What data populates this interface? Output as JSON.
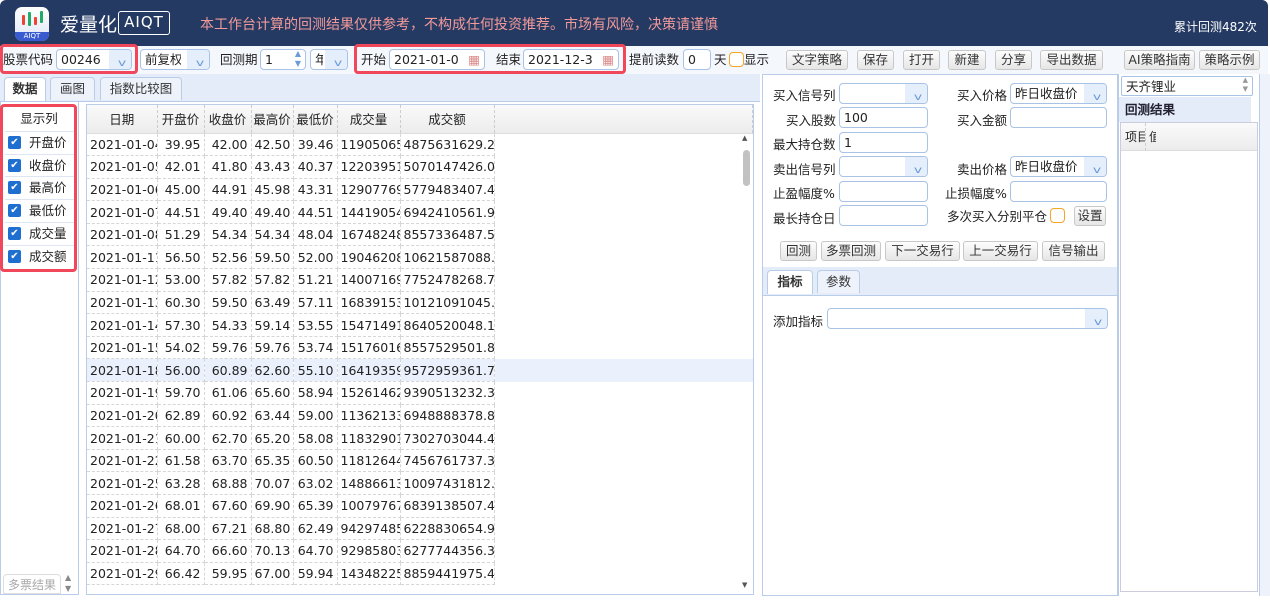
{
  "header": {
    "logo_text": "AIQT",
    "app_name": "爱量化",
    "badge": "AIQT",
    "disclaimer": "本工作台计算的回测结果仅供参考，不构成任何投资推荐。市场有风险，决策请谨慎",
    "counter": "累计回测482次"
  },
  "toolbar": {
    "stock_code_label": "股票代码",
    "stock_code": "00246",
    "adjust": "前复权",
    "period_label": "回测期",
    "period_value": "1",
    "period_unit": "年",
    "start_label": "开始",
    "start_date": "2021-01-0",
    "end_label": "结束",
    "end_date": "2021-12-3",
    "preload_label": "提前读数",
    "preload_value": "0",
    "day_label": "天",
    "show_label": "显示",
    "buttons": [
      "文字策略",
      "保存",
      "打开",
      "新建",
      "分享",
      "导出数据",
      "AI策略指南",
      "策略示例"
    ]
  },
  "tabs": [
    "数据",
    "画图",
    "指数比较图"
  ],
  "columns_panel": {
    "title": "显示列",
    "items": [
      "开盘价",
      "收盘价",
      "最高价",
      "最低价",
      "成交量",
      "成交额"
    ],
    "multi_results": "多票结果"
  },
  "table": {
    "headers": [
      "日期",
      "开盘价",
      "收盘价",
      "最高价",
      "最低价",
      "成交量",
      "成交额"
    ],
    "rows": [
      [
        "2021-01-04",
        "39.95",
        "42.00",
        "42.50",
        "39.46",
        "119050657",
        "4875631629.20"
      ],
      [
        "2021-01-05",
        "42.01",
        "41.80",
        "43.43",
        "40.37",
        "122039516",
        "5070147426.00"
      ],
      [
        "2021-01-06",
        "45.00",
        "44.91",
        "45.98",
        "43.31",
        "129077691",
        "5779483407.42"
      ],
      [
        "2021-01-07",
        "44.51",
        "49.40",
        "49.40",
        "44.51",
        "144190548",
        "6942410561.97"
      ],
      [
        "2021-01-08",
        "51.29",
        "54.34",
        "54.34",
        "48.04",
        "167482482",
        "8557336487.56"
      ],
      [
        "2021-01-11",
        "56.50",
        "52.56",
        "59.50",
        "52.00",
        "190462089",
        "10621587088.2"
      ],
      [
        "2021-01-12",
        "53.00",
        "57.82",
        "57.82",
        "51.21",
        "140071699",
        "7752478268.78"
      ],
      [
        "2021-01-13",
        "60.30",
        "59.50",
        "63.49",
        "57.11",
        "168391532",
        "10121091045.6"
      ],
      [
        "2021-01-14",
        "57.30",
        "54.33",
        "59.14",
        "53.55",
        "154714912",
        "8640520048.11"
      ],
      [
        "2021-01-15",
        "54.02",
        "59.76",
        "59.76",
        "53.74",
        "151760166",
        "8557529501.84"
      ],
      [
        "2021-01-18",
        "56.00",
        "60.89",
        "62.60",
        "55.10",
        "164193598",
        "9572959361.71"
      ],
      [
        "2021-01-19",
        "59.70",
        "61.06",
        "65.60",
        "58.94",
        "152614628",
        "9390513232.32"
      ],
      [
        "2021-01-20",
        "62.89",
        "60.92",
        "63.44",
        "59.00",
        "113621339",
        "6948888378.84"
      ],
      [
        "2021-01-21",
        "60.00",
        "62.70",
        "65.20",
        "58.08",
        "118329014",
        "7302703044.44"
      ],
      [
        "2021-01-22",
        "61.58",
        "63.70",
        "65.35",
        "60.50",
        "118126442",
        "7456761737.35"
      ],
      [
        "2021-01-25",
        "63.28",
        "68.88",
        "70.07",
        "63.02",
        "148866139",
        "10097431812.6"
      ],
      [
        "2021-01-26",
        "68.01",
        "67.60",
        "69.90",
        "65.39",
        "100797678",
        "6839138507.48"
      ],
      [
        "2021-01-27",
        "68.00",
        "67.21",
        "68.80",
        "62.49",
        "94297485",
        "6228830654.97"
      ],
      [
        "2021-01-28",
        "64.70",
        "66.60",
        "70.13",
        "64.70",
        "92985803",
        "6277744356.39"
      ],
      [
        "2021-01-29",
        "66.42",
        "59.95",
        "67.00",
        "59.94",
        "143482252",
        "8859441975.41"
      ]
    ],
    "selected_row": 10
  },
  "form": {
    "buy_signal_label": "买入信号列",
    "buy_signal": "",
    "buy_price_label": "买入价格",
    "buy_price": "昨日收盘价",
    "buy_shares_label": "买入股数",
    "buy_shares": "100",
    "buy_amount_label": "买入金额",
    "buy_amount": "",
    "max_pos_label": "最大持仓数",
    "max_pos": "1",
    "sell_signal_label": "卖出信号列",
    "sell_signal": "",
    "sell_price_label": "卖出价格",
    "sell_price": "昨日收盘价",
    "take_profit_label": "止盈幅度%",
    "take_profit": "",
    "stop_loss_label": "止损幅度%",
    "stop_loss": "",
    "max_hold_label": "最长持仓日",
    "max_hold": "",
    "multi_close_label": "多次买入分别平仓",
    "settings_label": "设置",
    "actions": [
      "回测",
      "多票回测",
      "下一交易行",
      "上一交易行",
      "信号输出"
    ],
    "subtabs": [
      "指标",
      "参数"
    ],
    "add_indicator_label": "添加指标",
    "add_indicator": ""
  },
  "results": {
    "stock_name": "天齐锂业",
    "title": "回测结果",
    "headers": [
      "项目",
      "值"
    ]
  },
  "colors": {
    "header_bg": "#253a63",
    "disclaimer": "#f29a9a",
    "highlight": "#f0475a",
    "accent": "#1f6fd0"
  }
}
